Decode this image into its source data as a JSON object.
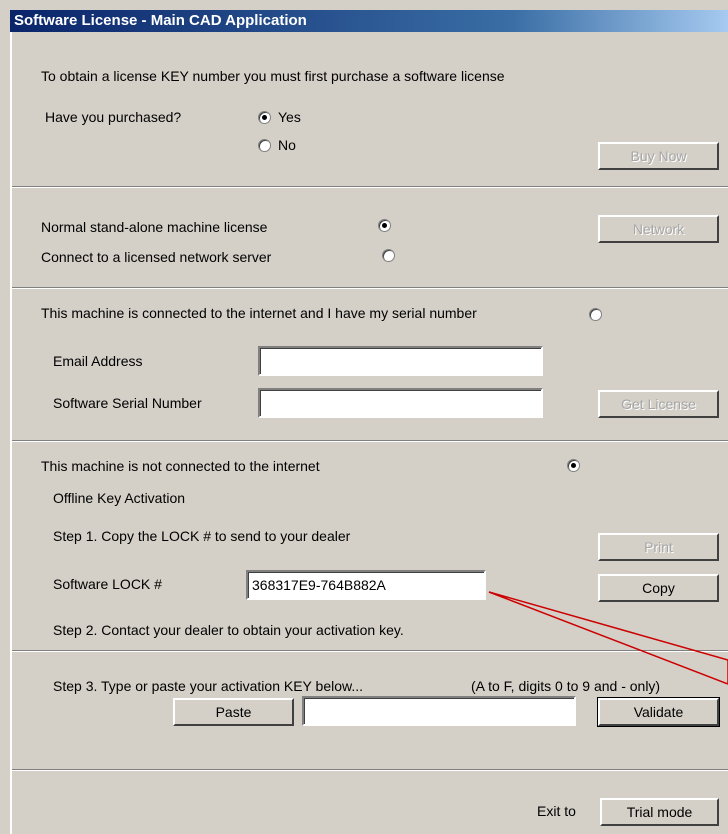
{
  "window": {
    "title": "Software License - Main CAD Application"
  },
  "purchase": {
    "intro": "To obtain a license KEY number you must first purchase a software license",
    "question": "Have you purchased?",
    "yes_label": "Yes",
    "no_label": "No",
    "selected": "Yes",
    "buy_now_label": "Buy Now"
  },
  "license_type": {
    "standalone_label": "Normal stand-alone machine license",
    "network_label": "Connect to a licensed network server",
    "selected": "standalone",
    "network_button_label": "Network"
  },
  "online": {
    "label": "This machine is connected to the internet and I have my serial number",
    "email_label": "Email Address",
    "email_value": "",
    "serial_label": "Software Serial Number",
    "serial_value": "",
    "get_license_label": "Get License"
  },
  "offline": {
    "label": "This machine is not connected to the internet",
    "heading": "Offline Key Activation",
    "step1": "Step 1.  Copy the LOCK # to send to your dealer",
    "print_label": "Print",
    "lock_label": "Software LOCK #",
    "lock_value": "368317E9-764B882A",
    "copy_label": "Copy",
    "step2": "Step 2.  Contact your dealer to obtain your activation key.",
    "step3": "Step 3.  Type or paste your activation KEY below...",
    "key_hint": "(A to F, digits 0 to 9 and - only)",
    "paste_label": "Paste",
    "key_value": "",
    "validate_label": "Validate"
  },
  "footer": {
    "exit_label": "Exit to",
    "trial_label": "Trial mode"
  },
  "colors": {
    "title_bar": "#0a246a",
    "dialog_bg": "#d4d0c8",
    "annotation_arrow": "#cc0000"
  }
}
